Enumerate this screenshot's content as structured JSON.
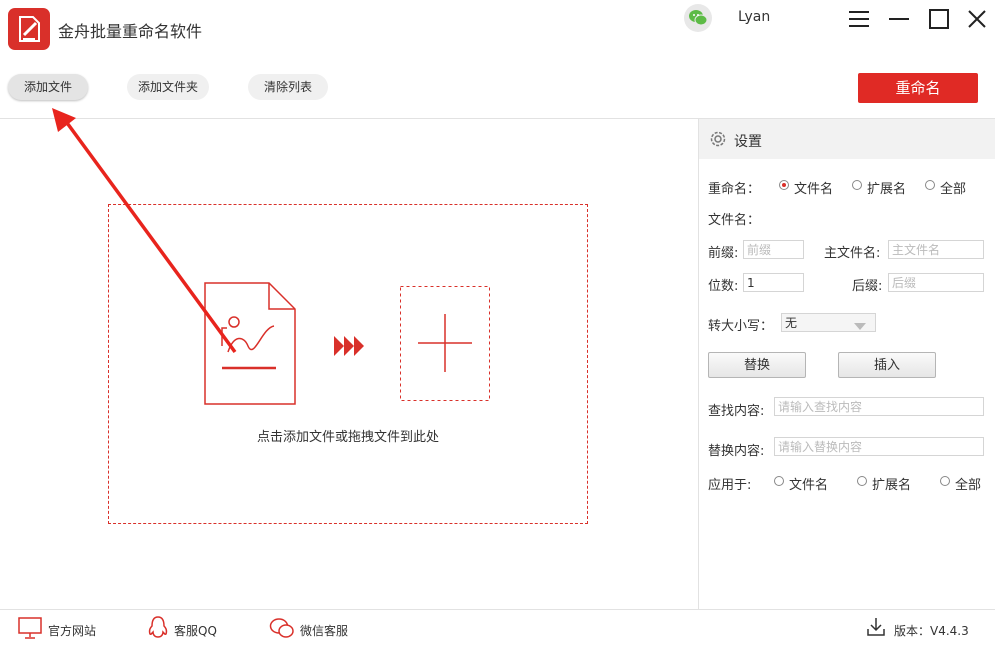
{
  "app": {
    "title": "金舟批量重命名软件",
    "user": "Lyan"
  },
  "toolbar": {
    "add_file": "添加文件",
    "add_folder": "添加文件夹",
    "clear_list": "清除列表",
    "rename": "重命名"
  },
  "drop_zone": {
    "hint": "点击添加文件或拖拽文件到此处"
  },
  "settings": {
    "title": "设置",
    "rename_label": "重命名：",
    "rename_options": [
      "文件名",
      "扩展名",
      "全部"
    ],
    "rename_selected": "文件名",
    "filename_label": "文件名：",
    "prefix_label": "前缀:",
    "prefix_placeholder": "前缀",
    "main_name_label": "主文件名:",
    "main_name_placeholder": "主文件名",
    "digits_label": "位数:",
    "digits_value": "1",
    "suffix_label": "后缀:",
    "suffix_placeholder": "后缀",
    "case_label": "转大小写：",
    "case_value": "无",
    "replace_button": "替换",
    "insert_button": "插入",
    "find_label": "查找内容:",
    "find_placeholder": "请输入查找内容",
    "replace_label": "替换内容:",
    "replace_placeholder": "请输入替换内容",
    "apply_label": "应用于:",
    "apply_options": [
      "文件名",
      "扩展名",
      "全部"
    ]
  },
  "footer": {
    "website": "官方网站",
    "qq": "客服QQ",
    "wechat": "微信客服",
    "version": "版本：V4.4.3"
  },
  "colors": {
    "accent": "#d9302a",
    "rename_button": "#e02a25"
  }
}
